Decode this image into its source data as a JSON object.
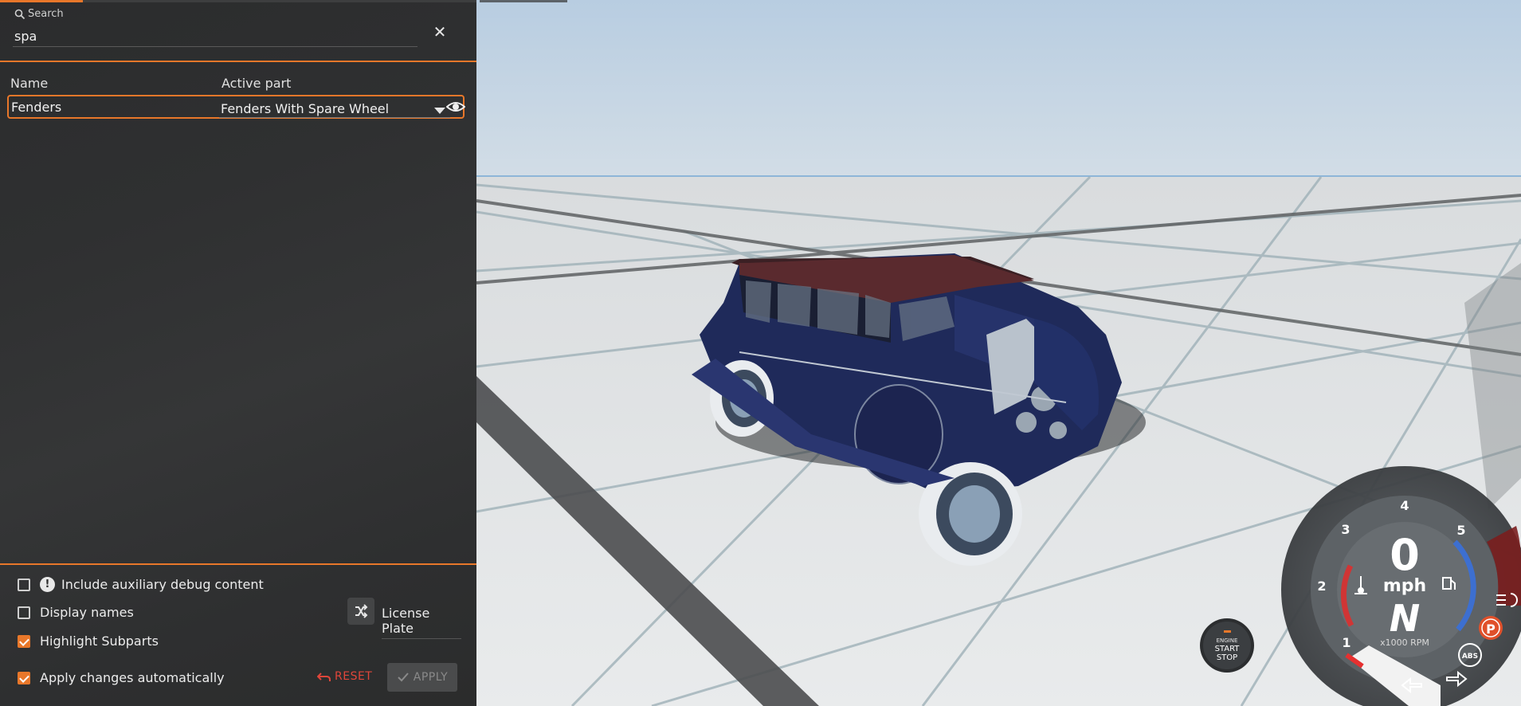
{
  "search": {
    "label": "Search",
    "value": "spa"
  },
  "table": {
    "col_name": "Name",
    "col_active": "Active part",
    "rows": [
      {
        "name": "Fenders",
        "active_part": "Fenders With Spare Wheel"
      }
    ]
  },
  "options": {
    "aux_debug": {
      "label": "Include auxiliary debug content",
      "checked": false
    },
    "display_names": {
      "label": "Display names",
      "checked": false
    },
    "highlight": {
      "label": "Highlight Subparts",
      "checked": true
    },
    "apply_auto": {
      "label": "Apply changes automatically",
      "checked": true
    }
  },
  "license_plate_label": "License Plate",
  "buttons": {
    "reset": "RESET",
    "apply": "APPLY"
  },
  "hud": {
    "engine_button": {
      "line1": "ENGINE",
      "line2": "START",
      "line3": "STOP"
    },
    "speed": "0",
    "speed_unit": "mph",
    "gear": "N",
    "rpm_unit": "x1000 RPM",
    "rpm_ticks": [
      "1",
      "2",
      "3",
      "4",
      "5"
    ],
    "parking_indicator": "P",
    "abs_indicator": "ABS"
  },
  "colors": {
    "accent": "#e8772a",
    "panel_bg": "#2f3031",
    "reset_red": "#e0463a",
    "car_body": "#1f2a5a",
    "car_roof": "#5a2a2e"
  }
}
